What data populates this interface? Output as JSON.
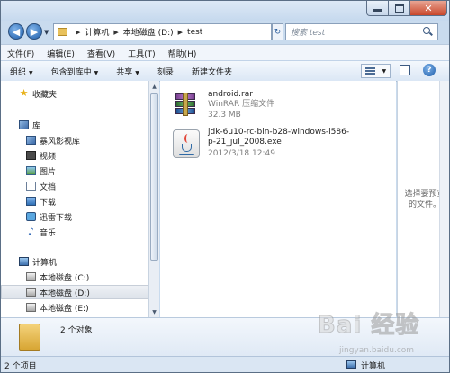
{
  "address": {
    "crumbs": [
      "计算机",
      "本地磁盘 (D:)",
      "test"
    ],
    "search_placeholder": "搜索 test"
  },
  "menu": [
    "文件(F)",
    "编辑(E)",
    "查看(V)",
    "工具(T)",
    "帮助(H)"
  ],
  "toolbar": {
    "organize": "组织",
    "include_library": "包含到库中",
    "share": "共享",
    "burn": "刻录",
    "new_folder": "新建文件夹"
  },
  "nav": {
    "favorites": "收藏夹",
    "libraries": "库",
    "library_items": [
      "暴风影视库",
      "视频",
      "图片",
      "文档",
      "下载",
      "迅雷下载",
      "音乐"
    ],
    "computer": "计算机",
    "drives": [
      "本地磁盘 (C:)",
      "本地磁盘 (D:)",
      "本地磁盘 (E:)"
    ]
  },
  "files": [
    {
      "name": "android.rar",
      "type": "WinRAR 压缩文件",
      "size": "32.3 MB",
      "icon": "winrar-archive-icon"
    },
    {
      "name": "jdk-6u10-rc-bin-b28-windows-i586-p-21_jul_2008.exe",
      "date": "2012/3/18 12:49",
      "icon": "java-exe-icon"
    }
  ],
  "preview": {
    "text": "选择要预览的文件。"
  },
  "details": {
    "count_text": "2 个对象"
  },
  "status": {
    "left": "2 个项目",
    "right": "计算机"
  },
  "watermark": {
    "logo": "Bai 经验",
    "url": "jingyan.baidu.com"
  },
  "colors": {
    "frame": "#c9dbee",
    "close": "#c9472b",
    "accent": "#1d5ca8"
  }
}
